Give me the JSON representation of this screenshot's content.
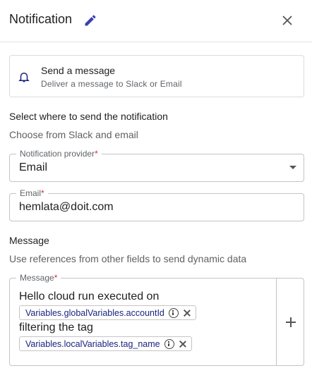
{
  "header": {
    "title": "Notification",
    "edit_icon": "pencil-icon",
    "close_icon": "close-icon"
  },
  "action_card": {
    "icon": "bell-icon",
    "title": "Send a message",
    "subtitle": "Deliver a message to Slack or Email"
  },
  "destination": {
    "title": "Select where to send the notification",
    "subtitle": "Choose from Slack and email"
  },
  "provider": {
    "label": "Notification provider",
    "required_mark": "*",
    "value": "Email"
  },
  "email": {
    "label": "Email",
    "required_mark": "*",
    "value": "hemlata@doit.com"
  },
  "message_section": {
    "title": "Message",
    "subtitle": "Use references from other fields to send dynamic data"
  },
  "message": {
    "label": "Message",
    "required_mark": "*",
    "line1": "Hello cloud run executed on",
    "chip1": "Variables.globalVariables.accountId",
    "line2": "filtering the tag",
    "chip2": "Variables.localVariables.tag_name",
    "add_icon": "plus-icon"
  },
  "colors": {
    "accent": "#3b3fb0",
    "chip_text": "#1a237e",
    "required": "#d32f2f"
  }
}
